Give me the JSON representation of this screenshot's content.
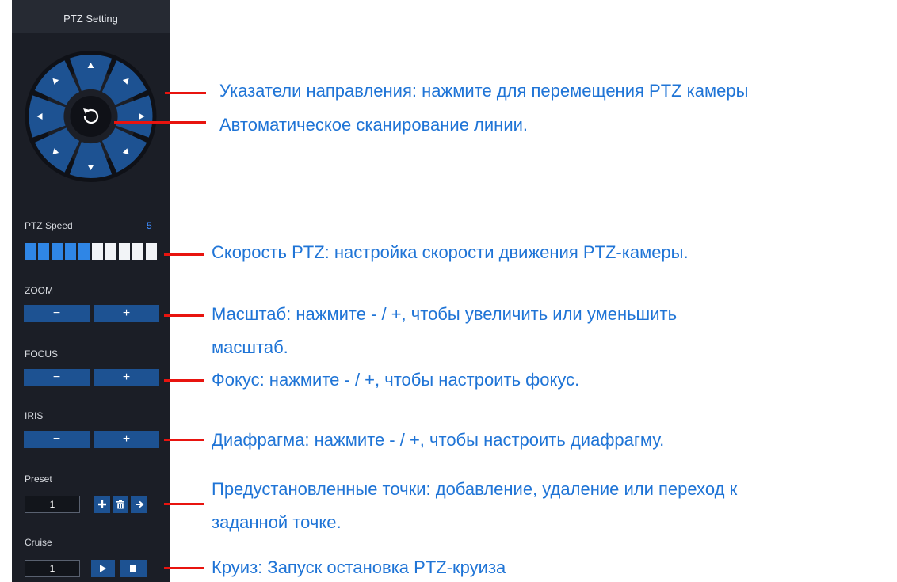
{
  "panel": {
    "title": "PTZ Setting",
    "speed": {
      "label": "PTZ Speed",
      "value": "5",
      "level": 5,
      "segments": 10,
      "accent": "#2f86e6"
    },
    "zoom": {
      "label": "ZOOM",
      "minus": "−",
      "plus": "+"
    },
    "focus": {
      "label": "FOCUS",
      "minus": "−",
      "plus": "+"
    },
    "iris": {
      "label": "IRIS",
      "minus": "−",
      "plus": "+"
    },
    "preset": {
      "label": "Preset",
      "value": "1",
      "icons": [
        "plus-icon",
        "trash-icon",
        "arrow-right-icon"
      ]
    },
    "cruise": {
      "label": "Cruise",
      "value": "1",
      "icons": [
        "play-icon",
        "stop-icon"
      ]
    }
  },
  "annotations": {
    "direction": "Указатели направления: нажмите для перемещения PTZ камеры",
    "autoscan": "Автоматическое сканирование линии.",
    "speed": "Скорость PTZ: настройка скорости движения PTZ-камеры.",
    "zoom_1": "Масштаб: нажмите - / +, чтобы увеличить или уменьшить",
    "zoom_2": "масштаб.",
    "focus": "Фокус: нажмите - / +, чтобы настроить фокус.",
    "iris": "Диафрагма: нажмите - / +, чтобы настроить диафрагму.",
    "preset_1": "Предустановленные точки: добавление, удаление или переход к",
    "preset_2": "заданной точке.",
    "cruise": "Круиз: Запуск остановка PTZ-круиза"
  },
  "colors": {
    "panel_bg": "#1b1e26",
    "button": "#1d5292",
    "callout_text": "#1f74d6",
    "callout_line": "#e8140f"
  }
}
